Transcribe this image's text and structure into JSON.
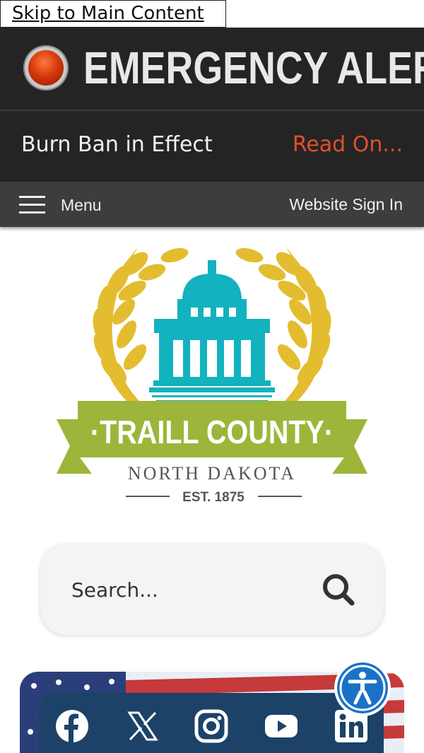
{
  "skip_link": "Skip to Main Content",
  "alert": {
    "title": "EMERGENCY ALERT",
    "message": "Burn Ban in Effect",
    "read_more": "Read On..."
  },
  "nav": {
    "menu_label": "Menu",
    "sign_in": "Website Sign In"
  },
  "logo": {
    "name": "·TRAILL COUNTY·",
    "state": "NORTH DAKOTA",
    "established": "EST. 1875",
    "colors": {
      "wheat": "#e3bd2f",
      "building": "#12b2be",
      "banner": "#9db53a"
    }
  },
  "search": {
    "placeholder": "Search..."
  },
  "social": {
    "icons": [
      "facebook-icon",
      "x-icon",
      "instagram-icon",
      "youtube-icon",
      "linkedin-icon"
    ],
    "bar_color": "#1d4268"
  },
  "accessibility": {
    "icon": "accessibility-icon",
    "color": "#1a72c8"
  },
  "colors": {
    "alert_bg": "#242424",
    "read_more": "#e0502a",
    "nav_bg": "#3d3d3d"
  }
}
